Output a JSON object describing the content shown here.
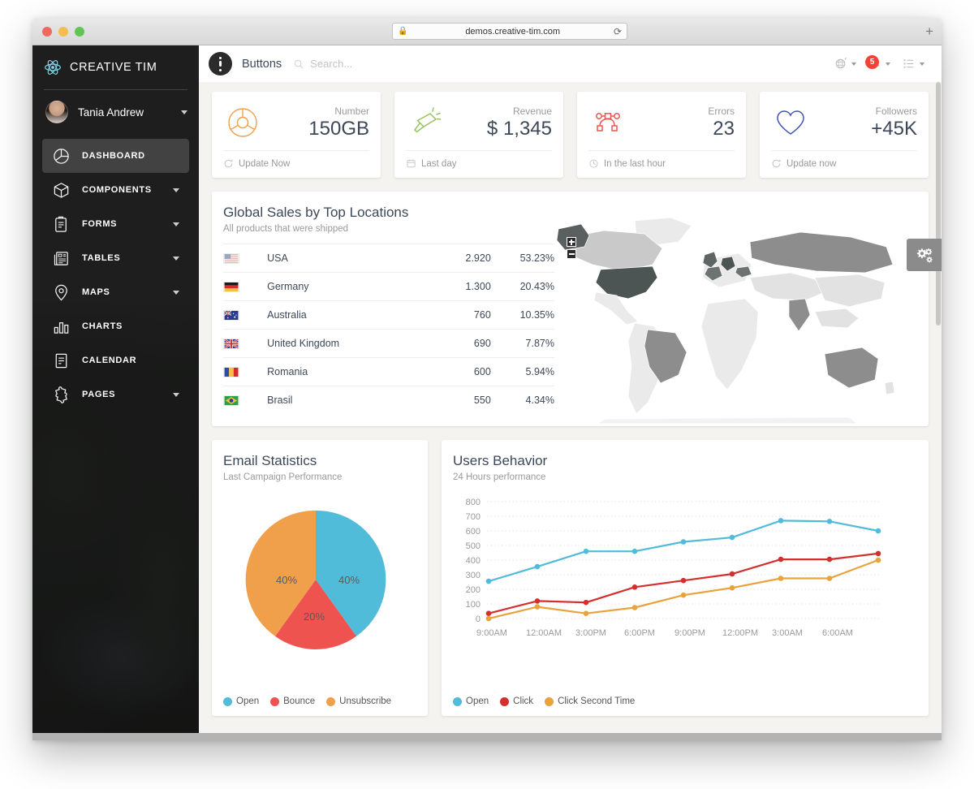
{
  "browser": {
    "url": "demos.creative-tim.com",
    "lock_icon": "lock-icon",
    "reload_icon": "reload-icon",
    "newtab_label": "+"
  },
  "sidebar": {
    "brand": "CREATIVE TIM",
    "brand_icon": "atom-icon",
    "user": {
      "name": "Tania Andrew",
      "avatar_icon": "avatar",
      "caret_icon": "chevron-down-icon"
    },
    "items": [
      {
        "label": "DASHBOARD",
        "icon": "pie-chart-icon",
        "active": true,
        "caret": false
      },
      {
        "label": "COMPONENTS",
        "icon": "cube-icon",
        "active": false,
        "caret": true
      },
      {
        "label": "FORMS",
        "icon": "clipboard-icon",
        "active": false,
        "caret": true
      },
      {
        "label": "TABLES",
        "icon": "table-icon",
        "active": false,
        "caret": true
      },
      {
        "label": "MAPS",
        "icon": "map-pin-icon",
        "active": false,
        "caret": true
      },
      {
        "label": "CHARTS",
        "icon": "bar-chart-icon",
        "active": false,
        "caret": false
      },
      {
        "label": "CALENDAR",
        "icon": "calendar-icon",
        "active": false,
        "caret": false
      },
      {
        "label": "PAGES",
        "icon": "puzzle-icon",
        "active": false,
        "caret": true
      }
    ]
  },
  "topbar": {
    "menu_icon": "kebab-menu-icon",
    "title": "Buttons",
    "search_placeholder": "Search...",
    "search_value": "",
    "search_icon": "search-icon",
    "actions": [
      {
        "icon": "dashboard-globe-icon",
        "badge": null
      },
      {
        "icon": "bell-icon",
        "badge": "5"
      },
      {
        "icon": "list-icon",
        "badge": null
      }
    ]
  },
  "stats": [
    {
      "icon": "donut-icon",
      "color": "#f0a04b",
      "label": "Number",
      "value": "150GB",
      "foot_icon": "refresh-icon",
      "foot": "Update Now"
    },
    {
      "icon": "spotlight-icon",
      "color": "#97c45e",
      "label": "Revenue",
      "value": "$ 1,345",
      "foot_icon": "calendar-icon",
      "foot": "Last day"
    },
    {
      "icon": "nodes-icon",
      "color": "#ef5350",
      "label": "Errors",
      "value": "23",
      "foot_icon": "clock-icon",
      "foot": "In the last hour"
    },
    {
      "icon": "heart-icon",
      "color": "#3f51b5",
      "label": "Followers",
      "value": "+45K",
      "foot_icon": "refresh-icon",
      "foot": "Update now"
    }
  ],
  "sales": {
    "title": "Global Sales by Top Locations",
    "subtitle": "All products that were shipped",
    "rows": [
      {
        "flag": "flag-usa",
        "country": "USA",
        "count": "2.920",
        "percent": "53.23%"
      },
      {
        "flag": "flag-germany",
        "country": "Germany",
        "count": "1.300",
        "percent": "20.43%"
      },
      {
        "flag": "flag-australia",
        "country": "Australia",
        "count": "760",
        "percent": "10.35%"
      },
      {
        "flag": "flag-uk",
        "country": "United Kingdom",
        "count": "690",
        "percent": "7.87%"
      },
      {
        "flag": "flag-romania",
        "country": "Romania",
        "count": "600",
        "percent": "5.94%"
      },
      {
        "flag": "flag-brazil",
        "country": "Brasil",
        "count": "550",
        "percent": "4.34%"
      }
    ],
    "map": {
      "zoom_in": "+",
      "zoom_out": "−"
    }
  },
  "settings_fab": {
    "icon": "gears-icon"
  },
  "chart_data": [
    {
      "type": "pie",
      "title": "Email Statistics",
      "subtitle": "Last Campaign Performance",
      "labels": [
        "Open",
        "Bounce",
        "Unsubscribe"
      ],
      "values": [
        40,
        20,
        40
      ],
      "value_labels": [
        "40%",
        "20%",
        "40%"
      ],
      "colors": [
        "#51bcda",
        "#ef5350",
        "#f0a04b"
      ],
      "legend_position": "bottom"
    },
    {
      "type": "line",
      "title": "Users Behavior",
      "subtitle": "24 Hours performance",
      "x": [
        "9:00AM",
        "12:00AM",
        "3:00PM",
        "6:00PM",
        "9:00PM",
        "12:00PM",
        "3:00AM",
        "6:00AM"
      ],
      "xlabel": "",
      "ylabel": "",
      "ylim": [
        0,
        800
      ],
      "yticks": [
        0,
        100,
        200,
        300,
        400,
        500,
        600,
        700,
        800
      ],
      "grid": true,
      "legend_position": "bottom",
      "series": [
        {
          "name": "Open",
          "color": "#51bcda",
          "values": [
            255,
            355,
            460,
            460,
            525,
            555,
            670,
            665,
            600
          ]
        },
        {
          "name": "Click",
          "color": "#d32f2f",
          "values": [
            35,
            120,
            110,
            215,
            260,
            305,
            405,
            405,
            445
          ]
        },
        {
          "name": "Click Second Time",
          "color": "#e8a33d",
          "values": [
            0,
            80,
            35,
            75,
            160,
            210,
            275,
            275,
            400
          ]
        }
      ]
    }
  ]
}
